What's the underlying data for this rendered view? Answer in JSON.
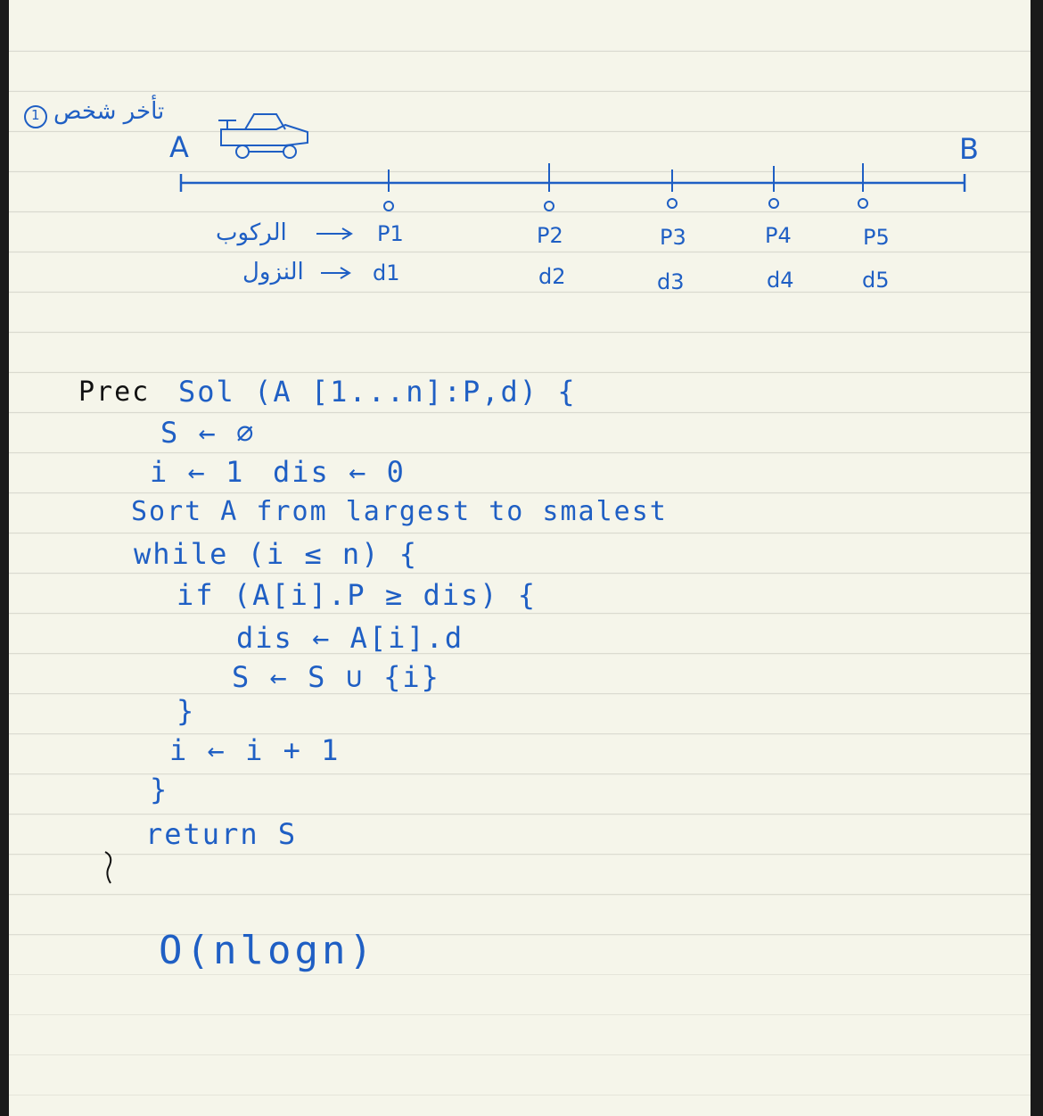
{
  "header_note": {
    "arabic": "تأخر شخص",
    "number": "1"
  },
  "endpoints": {
    "start": "A",
    "end": "B"
  },
  "stops": [
    {
      "p": "P1",
      "d": "d1"
    },
    {
      "p": "P2",
      "d": "d2"
    },
    {
      "p": "P3",
      "d": "d3"
    },
    {
      "p": "P4",
      "d": "d4"
    },
    {
      "p": "P5",
      "d": "d5"
    }
  ],
  "legend": {
    "boarding": "الركوب",
    "alighting": "النزول"
  },
  "code": {
    "prec": "Prec",
    "signature": "Sol (A [1...n]:P,d) {",
    "init_s": "S ← ∅",
    "init_i": "i ← 1",
    "init_dis": "dis ← 0",
    "sort": "Sort A from largest to smalest",
    "while": "while (i ≤ n) {",
    "if": "if (A[i].P ≥ dis) {",
    "assign_dis": "dis ← A[i].d",
    "assign_s": "S ← S ∪ {i}",
    "close_if": "}",
    "increment": "i ← i + 1",
    "close_while": "}",
    "return": "return S",
    "close_proc": "}"
  },
  "complexity": "O(nlogn)",
  "colors": {
    "ink": "#1f5fc4",
    "pencil": "#111111",
    "paper": "#f5f5ea",
    "rule": "#d9d9cf"
  }
}
